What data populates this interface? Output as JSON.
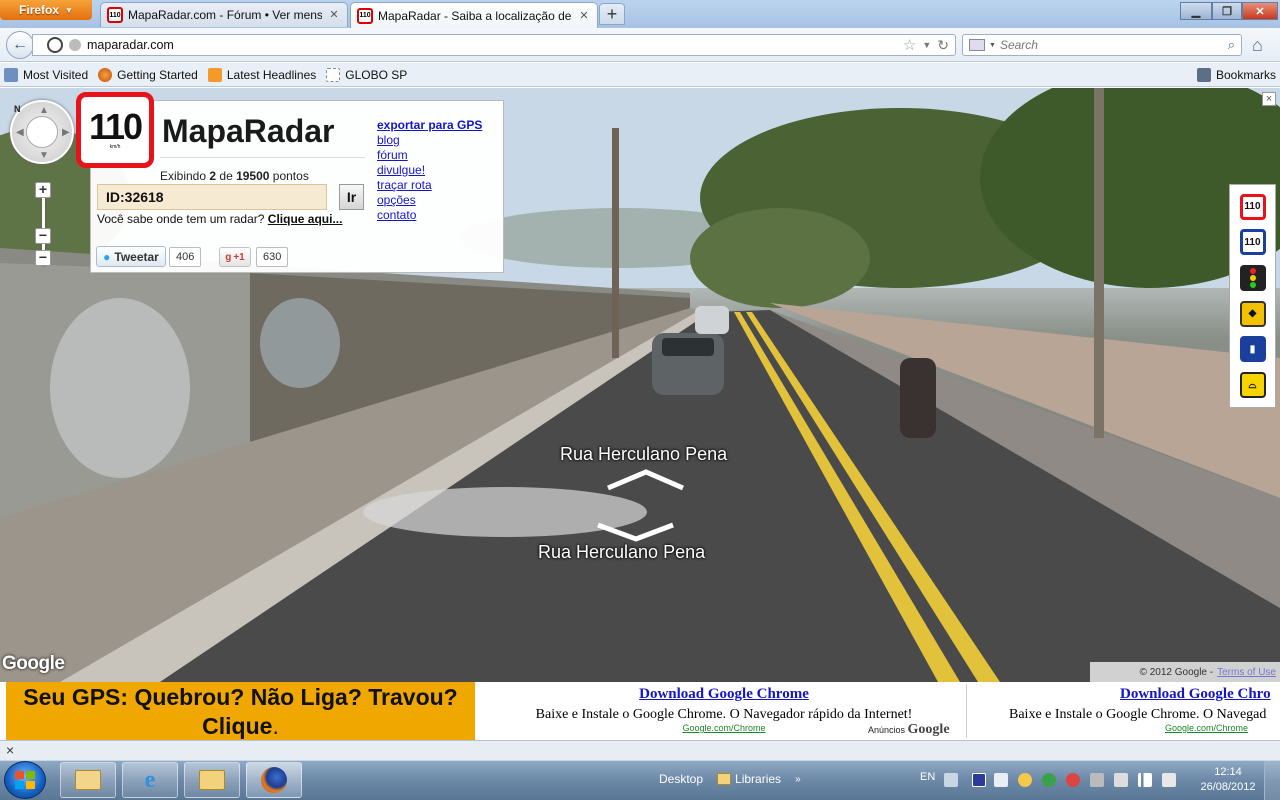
{
  "browser": {
    "menu_label": "Firefox",
    "tabs": [
      {
        "label": "MapaRadar.com - Fórum • Ver mens...",
        "favicon": "110"
      },
      {
        "label": "MapaRadar - Saiba a localização de t...",
        "favicon": "110"
      }
    ],
    "url": "maparadar.com",
    "search_placeholder": "Search",
    "bookmarks": [
      "Most Visited",
      "Getting Started",
      "Latest Headlines",
      "GLOBO SP"
    ],
    "bookmarks_menu": "Bookmarks"
  },
  "panel": {
    "badge_number": "110",
    "badge_unit": "km/h",
    "brand": "MapaRadar",
    "showing_prefix": "Exibindo ",
    "showing_current": "2",
    "showing_middle": " de ",
    "showing_total": "19500",
    "showing_suffix": " pontos",
    "id_value": "ID:32618",
    "go_label": "Ir",
    "ask_text": "Você sabe onde tem um radar? ",
    "ask_link": "Clique aqui...",
    "links": [
      "exportar para GPS",
      "blog",
      "fórum",
      "divulgue!",
      "traçar rota",
      "opções",
      "contato"
    ],
    "tweet_label": "Tweetar",
    "tweet_count": "406",
    "gplus_label": "+1",
    "gplus_count": "630"
  },
  "streetview": {
    "street_label_top": "Rua Herculano Pena",
    "street_label_bottom": "Rua Herculano Pena",
    "compass_north": "N",
    "google_logo": "Google",
    "copyright": "© 2012 Google -",
    "terms": "Terms of Use",
    "close": "×"
  },
  "icon_strip": [
    "speed-110-icon",
    "speed-110-blue-icon",
    "traffic-light-icon",
    "police-icon",
    "school-icon",
    "speed-bump-icon"
  ],
  "ads": {
    "gps_line1": "Seu GPS: Quebrou? Não Liga? Travou?",
    "gps_line2": "Clique",
    "gps_dot": ".",
    "chrome_title": "Download Google Chrome",
    "chrome_text": "Baixe e Instale o Google Chrome. O Navegador rápido da Internet!",
    "chrome_url": "Google.com/Chrome",
    "chrome_text_cut": "Baixe e Instale o Google Chrome. O Navegad",
    "chrome_title_cut": "Download Google Chro",
    "anuncios": "Anúncios",
    "anuncios_brand": "Google"
  },
  "statusbar": {
    "close": "×"
  },
  "taskbar": {
    "desktop_label": "Desktop",
    "libraries_label": "Libraries",
    "language": "EN",
    "time": "12:14",
    "date": "26/08/2012"
  },
  "colors": {
    "accent_red": "#e8121b",
    "link_blue": "#1515c8",
    "ad_yellow": "#f0a800"
  }
}
